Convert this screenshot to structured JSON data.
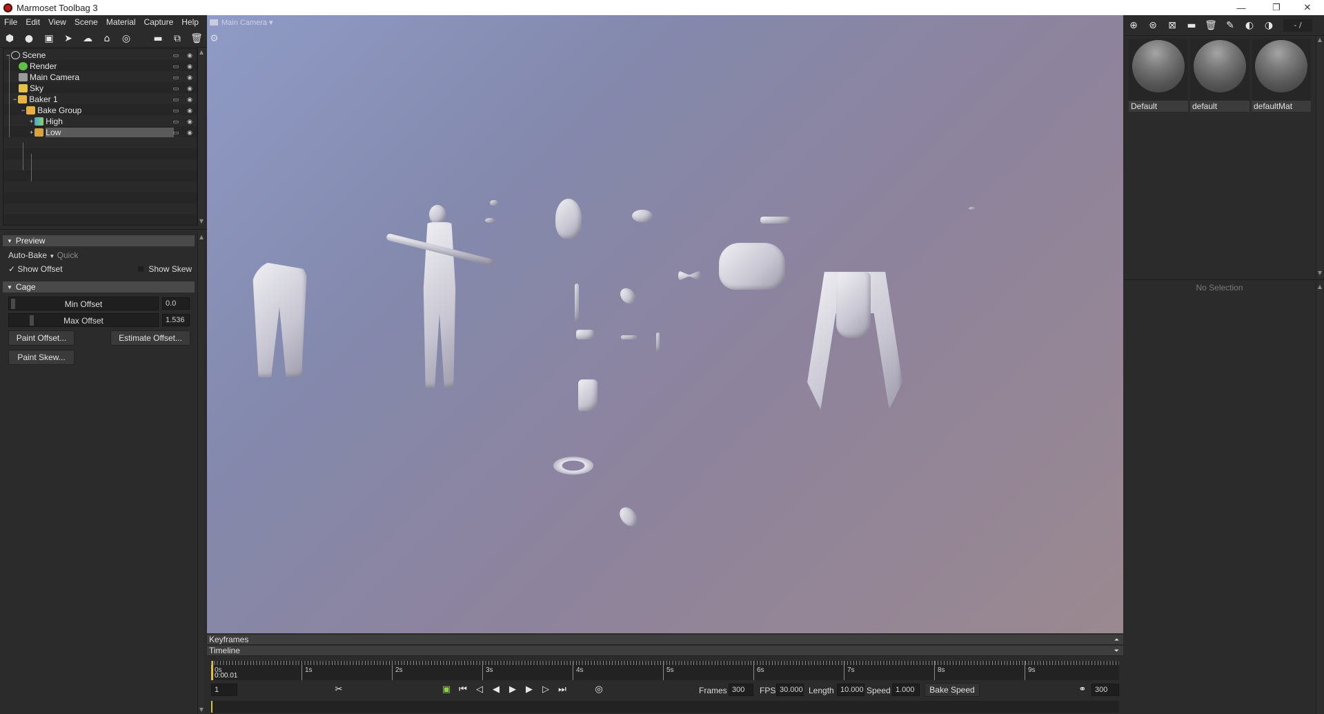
{
  "window": {
    "title": "Marmoset Toolbag 3",
    "minimize": "—",
    "restore": "❐",
    "close": "✕"
  },
  "menu": [
    "File",
    "Edit",
    "View",
    "Scene",
    "Material",
    "Capture",
    "Help"
  ],
  "toolbar_icons": [
    "object-icon",
    "light-icon",
    "camera-icon",
    "plane-icon",
    "sky-icon",
    "baker-icon",
    "render-icon",
    "folder-icon",
    "duplicate-icon",
    "trash-icon"
  ],
  "outliner": {
    "items": [
      {
        "label": "Scene",
        "icon": "scene-icon",
        "color": "#cfcfcf",
        "depth": 0
      },
      {
        "label": "Render",
        "icon": "render-icon",
        "color": "#5fbf4a",
        "depth": 1
      },
      {
        "label": "Main Camera",
        "icon": "camera-icon",
        "color": "#c9c9c9",
        "depth": 1
      },
      {
        "label": "Sky",
        "icon": "sky-icon",
        "color": "#e5c04a",
        "depth": 1
      },
      {
        "label": "Baker 1",
        "icon": "baker-icon",
        "color": "#e5b54a",
        "depth": 1
      },
      {
        "label": "Bake Group",
        "icon": "folder-icon",
        "color": "#e3b23c",
        "depth": 2
      },
      {
        "label": "High",
        "icon": "high-mesh-icon",
        "color": "#4aa7d6",
        "depth": 3
      },
      {
        "label": "Low",
        "icon": "low-mesh-icon",
        "color": "#d8a23c",
        "depth": 3
      }
    ]
  },
  "properties": {
    "preview_header": "Preview",
    "auto_bake": "Auto-Bake",
    "quick": "Quick",
    "show_offset": "Show Offset",
    "show_offset_check": "✓",
    "show_skew": "Show Skew",
    "cage_header": "Cage",
    "min_offset_label": "Min Offset",
    "min_offset_value": "0.0",
    "max_offset_label": "Max Offset",
    "max_offset_value": "1.536",
    "paint_offset": "Paint Offset...",
    "estimate_offset": "Estimate Offset...",
    "paint_skew": "Paint Skew..."
  },
  "viewport": {
    "camera": "Main Camera",
    "camera_arrow": "▾",
    "gear": "⚙"
  },
  "materials": {
    "toolbar_icons": [
      "add-material-icon",
      "copy-material-icon",
      "checker-icon",
      "folder-icon",
      "trash-icon",
      "picker-icon",
      "browse-icon",
      "library-icon"
    ],
    "zoom_label": "- /",
    "items": [
      {
        "label": "Default"
      },
      {
        "label": "default"
      },
      {
        "label": "defaultMat"
      }
    ],
    "no_selection": "No Selection"
  },
  "timeline": {
    "keyframes_label": "Keyframes",
    "timeline_label": "Timeline",
    "ticks": [
      "0s",
      "1s",
      "2s",
      "3s",
      "4s",
      "5s",
      "6s",
      "7s",
      "8s",
      "9s"
    ],
    "current_time": "0:00.01",
    "frame_field": "1",
    "frames_label": "Frames",
    "frames_value": "300",
    "fps_label": "FPS",
    "fps_value": "30.000",
    "length_label": "Length",
    "length_value": "10.000",
    "speed_label": "Speed",
    "speed_value": "1.000",
    "bake_speed": "Bake Speed",
    "end_frame": "300"
  }
}
